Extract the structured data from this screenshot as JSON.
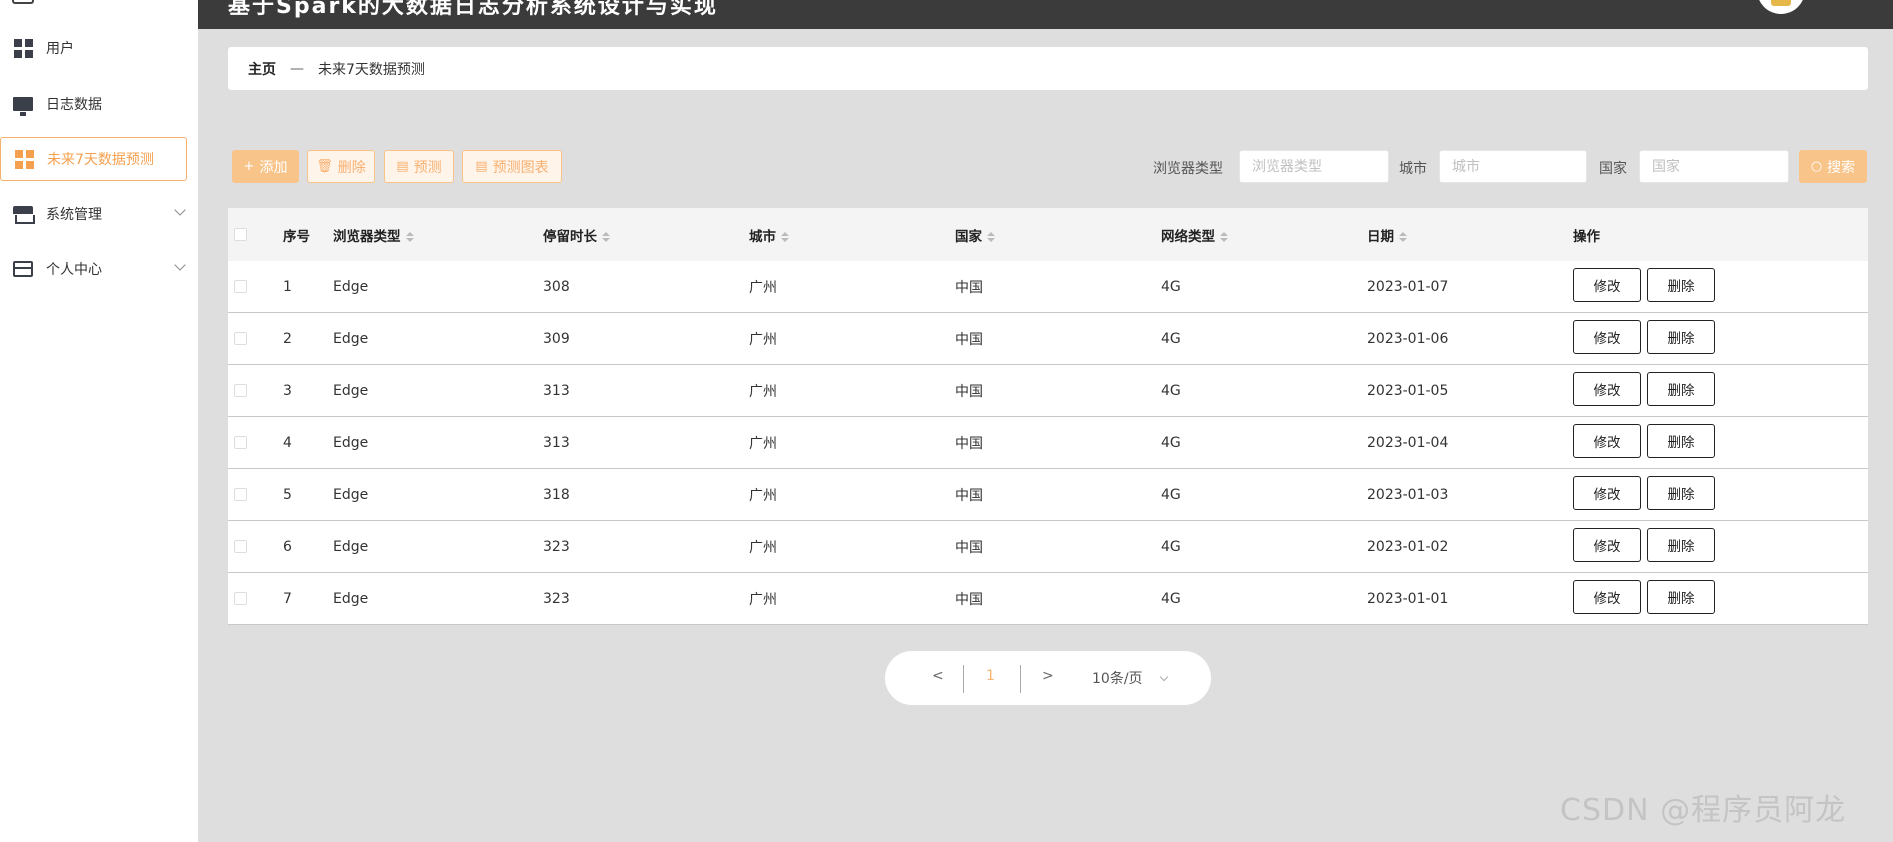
{
  "header": {
    "title": "基于Spark的大数据日志分析系统设计与实现"
  },
  "sidebar": {
    "items": [
      {
        "label": "用户",
        "icon": "grid-icon"
      },
      {
        "label": "日志数据",
        "icon": "monitor-icon"
      },
      {
        "label": "未来7天数据预测",
        "icon": "grid-icon",
        "active": true
      },
      {
        "label": "系统管理",
        "icon": "store-icon",
        "expandable": true
      },
      {
        "label": "个人中心",
        "icon": "card-icon",
        "expandable": true
      }
    ]
  },
  "breadcrumb": {
    "home": "主页",
    "separator": "—",
    "current": "未来7天数据预测"
  },
  "toolbar": {
    "add_label": "添加",
    "delete_label": "删除",
    "predict_label": "预测",
    "chart_label": "预测图表",
    "search_label": "搜索"
  },
  "filters": {
    "browser_label": "浏览器类型",
    "browser_placeholder": "浏览器类型",
    "city_label": "城市",
    "city_placeholder": "城市",
    "country_label": "国家",
    "country_placeholder": "国家"
  },
  "table": {
    "columns": [
      "序号",
      "浏览器类型",
      "停留时长",
      "城市",
      "国家",
      "网络类型",
      "日期",
      "操作"
    ],
    "edit_label": "修改",
    "delete_label": "删除",
    "rows": [
      [
        "1",
        "Edge",
        "308",
        "广州",
        "中国",
        "4G",
        "2023-01-07"
      ],
      [
        "2",
        "Edge",
        "309",
        "广州",
        "中国",
        "4G",
        "2023-01-06"
      ],
      [
        "3",
        "Edge",
        "313",
        "广州",
        "中国",
        "4G",
        "2023-01-05"
      ],
      [
        "4",
        "Edge",
        "313",
        "广州",
        "中国",
        "4G",
        "2023-01-04"
      ],
      [
        "5",
        "Edge",
        "318",
        "广州",
        "中国",
        "4G",
        "2023-01-03"
      ],
      [
        "6",
        "Edge",
        "323",
        "广州",
        "中国",
        "4G",
        "2023-01-02"
      ],
      [
        "7",
        "Edge",
        "323",
        "广州",
        "中国",
        "4G",
        "2023-01-01"
      ]
    ]
  },
  "pagination": {
    "prev": "<",
    "page": "1",
    "next": ">",
    "page_size": "10条/页"
  },
  "watermark": "CSDN @程序员阿龙",
  "colors": {
    "accent": "#f5a04f",
    "header_bg": "#3b3b3b",
    "page_bg": "#dedede"
  }
}
